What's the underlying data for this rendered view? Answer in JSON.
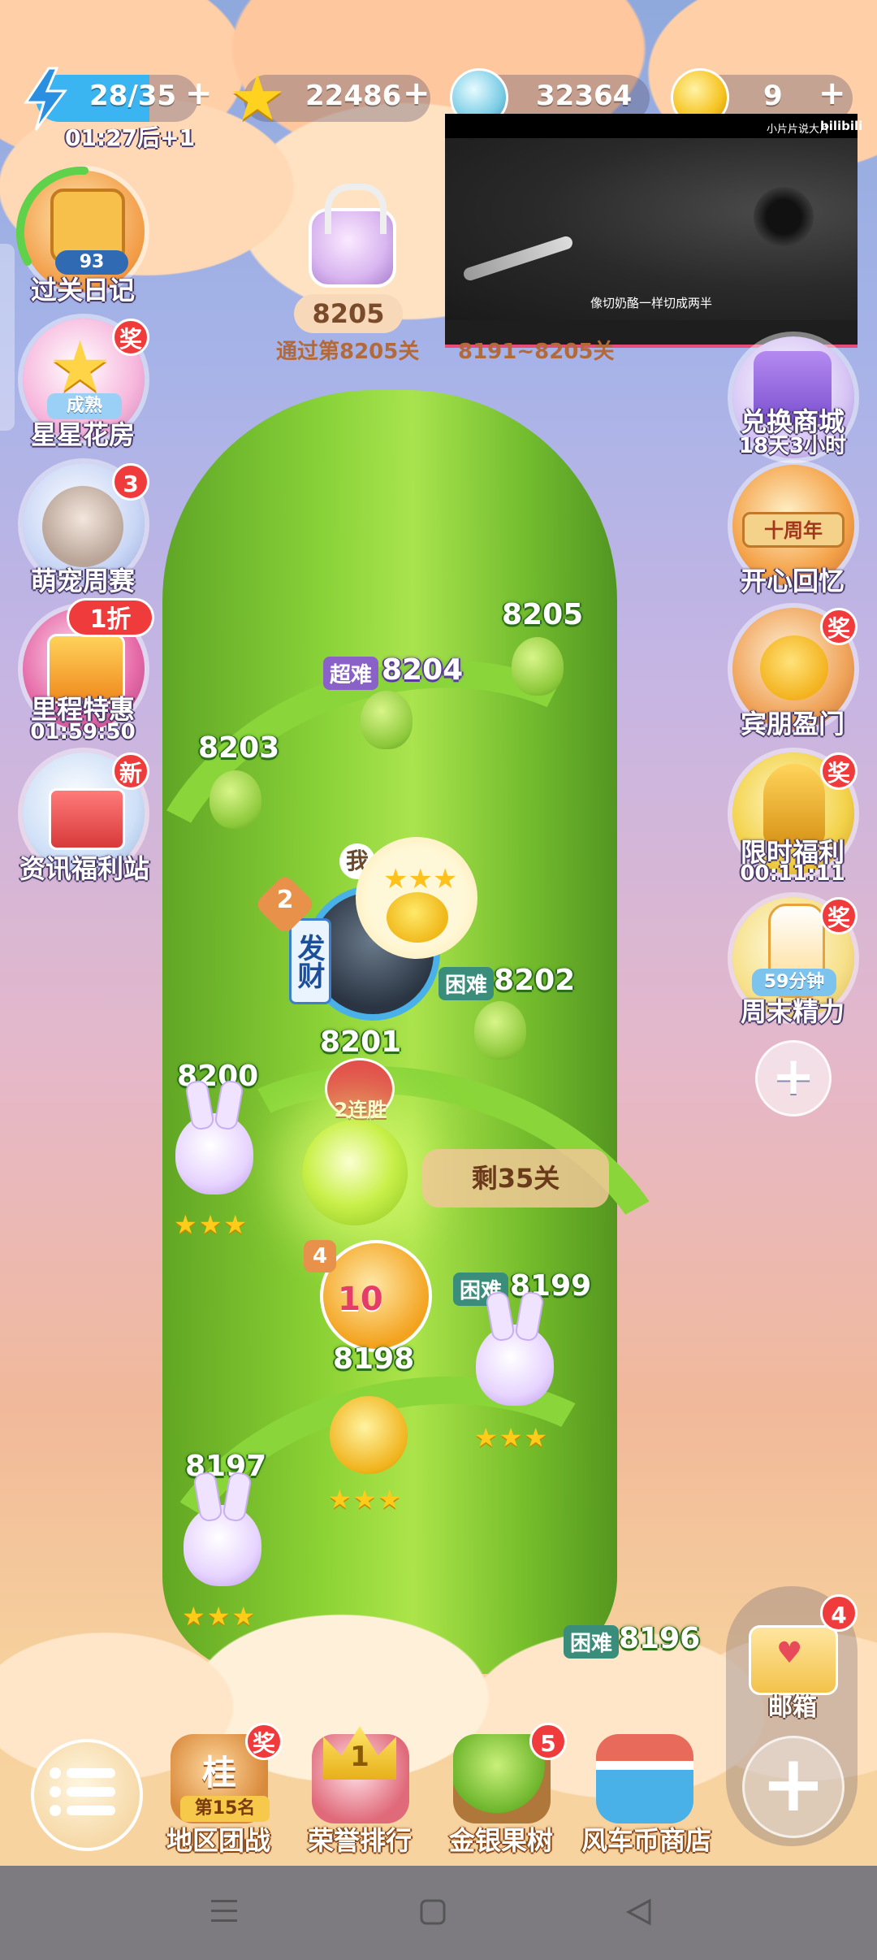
{
  "topbar": {
    "energy": "28/35",
    "energy_timer": "01:27后+1",
    "stars": "22486",
    "gems": "32364",
    "coins": "9",
    "plus": "+"
  },
  "video_popup": {
    "brand": "小片片说大片",
    "logo": "bilibili",
    "subtitle": "像切奶酪一样切成两半"
  },
  "goal": {
    "level": "8205",
    "text": "通过第8205关",
    "range": "8191~8205关"
  },
  "left_menu": [
    {
      "label": "过关日记",
      "sub": "93"
    },
    {
      "label": "星星花房",
      "tag": "成熟",
      "badge": "奖"
    },
    {
      "label": "萌宠周赛",
      "badge": "3"
    },
    {
      "label": "里程特惠",
      "badge": "1折",
      "timer": "01:59:50"
    },
    {
      "label": "资讯福利站",
      "badge": "新"
    }
  ],
  "right_menu": [
    {
      "label": "兑换商城",
      "timer": "18天3小时"
    },
    {
      "label": "开心回忆",
      "tag": "十周年"
    },
    {
      "label": "宾朋盈门",
      "badge": "奖"
    },
    {
      "label": "限时福利",
      "badge": "奖",
      "timer": "00:11:11"
    },
    {
      "label": "周末精力",
      "badge": "奖",
      "tag": "59分钟"
    }
  ],
  "levels": {
    "l8205": "8205",
    "l8204": "8204",
    "l8204_tag": "超难",
    "l8203": "8203",
    "l8202": "8202",
    "l8202_tag": "困难",
    "l8201": "8201",
    "l8201_streak": "2连胜",
    "l8200": "8200",
    "l8200_stars": "★★★",
    "l8199": "8199",
    "l8199_tag": "困难",
    "l8199_stars": "★★★",
    "l8198": "8198",
    "l8198_stars": "★★★",
    "l8197": "8197",
    "l8197_stars": "★★★",
    "l8196": "8196",
    "l8196_tag": "困难"
  },
  "player": {
    "me": "我",
    "rank": "2",
    "banner": "发财",
    "friend_rank": "4",
    "friend_badge": "10"
  },
  "remaining": "剩35关",
  "mail": {
    "label": "邮箱",
    "badge": "4"
  },
  "bottom_menu": [
    {
      "label": "地区团战",
      "sub": "第15名",
      "icon_text": "桂",
      "badge": "奖"
    },
    {
      "label": "荣誉排行",
      "icon_text": "1"
    },
    {
      "label": "金银果树",
      "badge": "5"
    },
    {
      "label": "风车币商店"
    }
  ],
  "colors": {
    "energy": "#3bb5f2",
    "badge": "#ef3b3b",
    "hard": "#3a8d7a",
    "super_hard": "#8a62c7"
  }
}
